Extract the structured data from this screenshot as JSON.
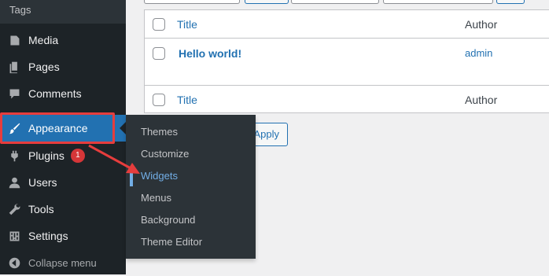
{
  "sidebar": {
    "top_label": "Tags",
    "items": [
      {
        "label": "Media",
        "icon": "media-icon"
      },
      {
        "label": "Pages",
        "icon": "pages-icon"
      },
      {
        "label": "Comments",
        "icon": "comments-icon"
      },
      {
        "label": "Appearance",
        "icon": "paintbrush-icon",
        "active": true
      },
      {
        "label": "Plugins",
        "icon": "plugins-icon",
        "badge": "1"
      },
      {
        "label": "Users",
        "icon": "users-icon"
      },
      {
        "label": "Tools",
        "icon": "tools-icon"
      },
      {
        "label": "Settings",
        "icon": "settings-icon"
      }
    ],
    "collapse_label": "Collapse menu"
  },
  "submenu": {
    "items": [
      "Themes",
      "Customize",
      "Widgets",
      "Menus",
      "Background",
      "Theme Editor"
    ],
    "current": "Widgets"
  },
  "table": {
    "header_title": "Title",
    "header_author": "Author",
    "rows": [
      {
        "title": "Hello world!",
        "author": "admin"
      }
    ],
    "footer_title": "Title",
    "footer_author": "Author"
  },
  "bulk": {
    "apply_label": "Apply"
  },
  "colors": {
    "sidebar_bg": "#1d2327",
    "accent": "#2271b1",
    "highlight": "#e63d3d",
    "badge": "#d63638"
  }
}
